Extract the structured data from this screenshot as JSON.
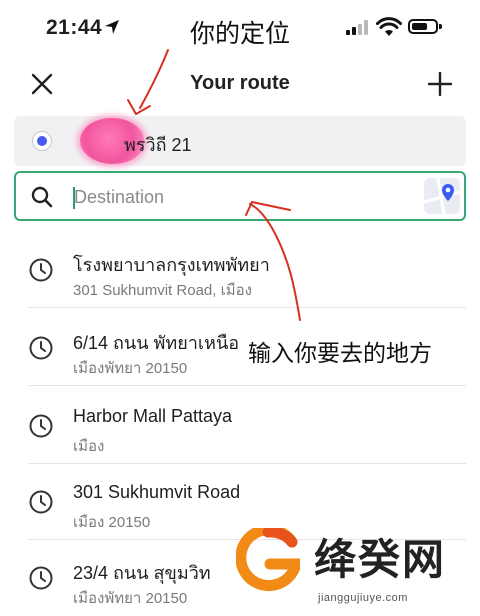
{
  "status_bar": {
    "time": "21:44"
  },
  "header": {
    "title": "Your route"
  },
  "origin": {
    "text": "พรวิถี 21"
  },
  "destination": {
    "placeholder": "Destination",
    "value": ""
  },
  "history": [
    {
      "title": "โรงพยาบาลกรุงเทพพัทยา",
      "subtitle": "301 Sukhumvit Road, เมือง"
    },
    {
      "title": "6/14 ถนน พัทยาเหนือ",
      "subtitle": "เมืองพัทยา 20150"
    },
    {
      "title": "Harbor Mall Pattaya",
      "subtitle": "เมือง"
    },
    {
      "title": "301 Sukhumvit Road",
      "subtitle": "เมือง 20150"
    },
    {
      "title": "23/4 ถนน สุขุมวิท",
      "subtitle": "เมืองพัทยา 20150"
    }
  ],
  "annotations": {
    "top_label": "你的定位",
    "middle_label": "输入你要去的地方"
  },
  "watermark": {
    "name": "绛癸网",
    "url": "jianggujiuye.com"
  },
  "colors": {
    "accent_green": "#3aa776",
    "origin_dot": "#4a5af0",
    "annotation_red": "#d8301f",
    "pin_blue": "#3b5bf5"
  },
  "icons": [
    "location-arrow-icon",
    "signal-icon",
    "wifi-icon",
    "battery-icon",
    "close-icon",
    "plus-icon",
    "search-icon",
    "map-pin-icon",
    "clock-icon"
  ]
}
